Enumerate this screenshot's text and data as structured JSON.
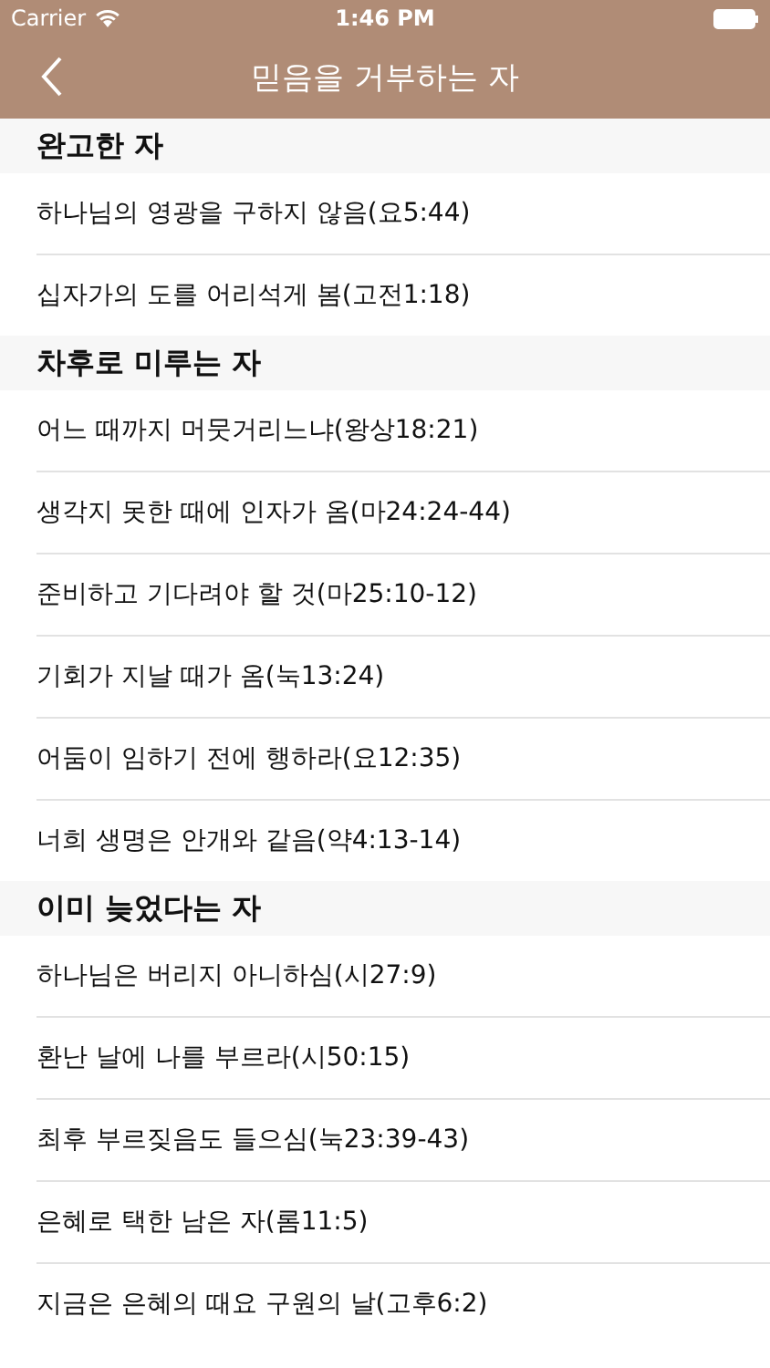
{
  "status_bar": {
    "carrier": "Carrier",
    "time": "1:46 PM"
  },
  "nav": {
    "title": "믿음을 거부하는 자"
  },
  "sections": [
    {
      "title": "완고한 자",
      "items": [
        "하나님의 영광을 구하지 않음(요5:44)",
        "십자가의 도를 어리석게 봄(고전1:18)"
      ]
    },
    {
      "title": "차후로 미루는 자",
      "items": [
        "어느 때까지 머뭇거리느냐(왕상18:21)",
        "생각지 못한 때에 인자가 옴(마24:24-44)",
        "준비하고 기다려야 할 것(마25:10-12)",
        "기회가 지날 때가 옴(눅13:24)",
        "어둠이 임하기 전에 행하라(요12:35)",
        "너희 생명은 안개와 같음(약4:13-14)"
      ]
    },
    {
      "title": "이미 늦었다는 자",
      "items": [
        "하나님은 버리지 아니하심(시27:9)",
        "환난 날에 나를 부르라(시50:15)",
        "최후 부르짖음도 들으심(눅23:39-43)",
        "은혜로 택한 남은 자(롬11:5)",
        "지금은 은혜의 때요 구원의 날(고후6:2)"
      ]
    }
  ]
}
